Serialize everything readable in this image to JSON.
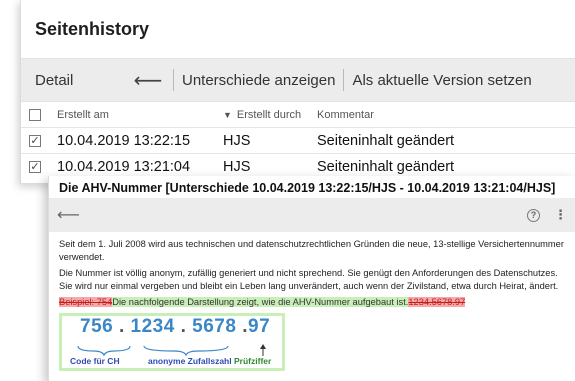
{
  "history": {
    "title": "Seitenhistory",
    "toolbar": {
      "detail_label": "Detail",
      "back_glyph": "⟵",
      "compare_label": "Unterschiede anzeigen",
      "set_version_label": "Als aktuelle Version setzen"
    },
    "columns": {
      "created_at": "Erstellt am",
      "created_by": "Erstellt durch",
      "comment": "Kommentar"
    },
    "rows": [
      {
        "date": "10.04.2019 13:22:15",
        "by": "HJS",
        "comment": "Seiteninhalt geändert",
        "checked": true
      },
      {
        "date": "10.04.2019 13:21:04",
        "by": "HJS",
        "comment": "Seiteninhalt geändert",
        "checked": true
      }
    ]
  },
  "diff": {
    "title": "Die AHV-Nummer [Unterschiede 10.04.2019 13:22:15/HJS - 10.04.2019 13:21:04/HJS]",
    "para1": "Seit dem 1. Juli 2008 wird aus technischen und datenschutzrechtlichen Gründen die neue, 13-stellige Versichertennummer verwendet.",
    "para2": "Die Nummer ist völlig anonym, zufällig generiert und nicht sprechend. Sie genügt den Anforderungen des Datenschutzes. Sie wird nur einmal vergeben und bleibt ein Leben lang unverändert, auch wenn der Zivilstand, etwa durch Heirat, ändert.",
    "deleted_prefix": "Beispiel: 754",
    "inserted_text": "Die nachfolgende Darstellung zeigt, wie die AHV-Nummer aufgebaut ist.",
    "deleted_suffix": "1234.5678.97",
    "ahv_graphic": {
      "part1": "756",
      "dot": ".",
      "part2": "1234",
      "part3": "5678",
      "part4a": "9",
      "part4b": "7",
      "label_country": "Code für CH",
      "label_random": "anonyme Zufallszahl",
      "label_check": "Prüfziffer"
    }
  }
}
